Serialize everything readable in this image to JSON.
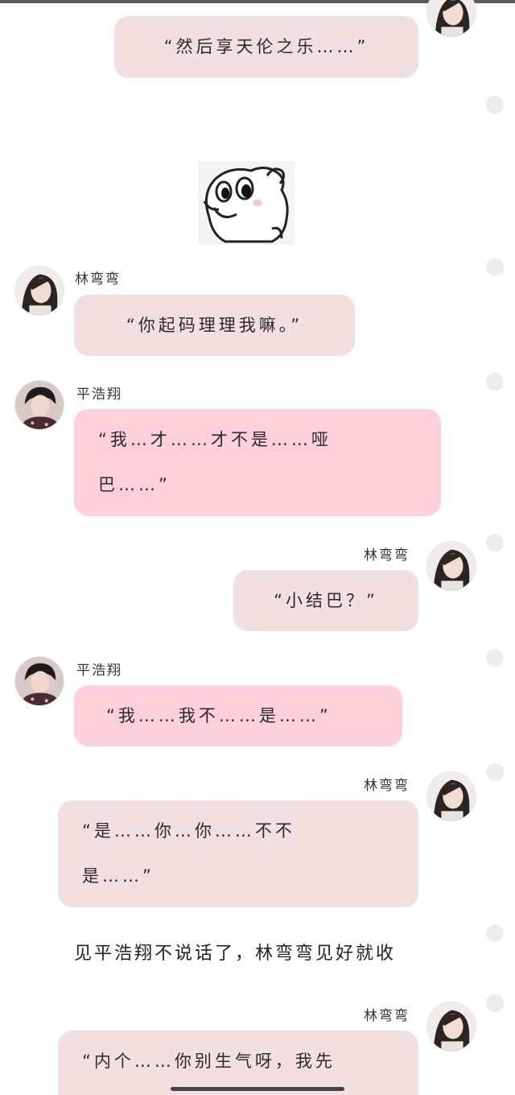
{
  "messages": [
    {
      "sender": "林弯弯",
      "text": "“然后享天伦之乐……”"
    },
    {
      "sender": "林弯弯",
      "text": "“你起码理理我嘛。”"
    },
    {
      "sender": "平浩翔",
      "line1": "“我…才……才不是……哑",
      "line2": "巴……”"
    },
    {
      "sender": "林弯弯",
      "text": "“小结巴？”"
    },
    {
      "sender": "平浩翔",
      "text": "“我……我不……是……”"
    },
    {
      "sender": "林弯弯",
      "line1": "“是……你…你……不不",
      "line2": "是……”"
    },
    {
      "sender": "林弯弯",
      "text": "“内个……你别生气呀，我先"
    }
  ],
  "narration": "见平浩翔不说话了，林弯弯见好就收",
  "sticker_icon": "cartoon-blob-sticker-icon",
  "colors": {
    "lin_bubble": "#f2dfe0",
    "ping_bubble": "#fdd0da",
    "background": "#ffffff"
  }
}
